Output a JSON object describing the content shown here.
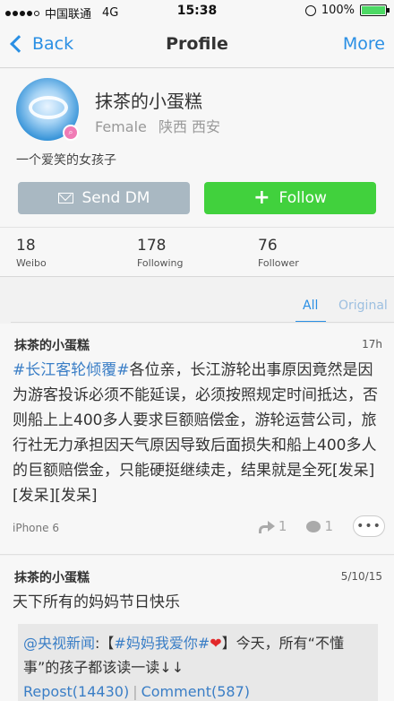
{
  "status_bar": {
    "carrier": "中国联通",
    "network": "4G",
    "time": "15:38",
    "battery": "100%",
    "battery_color": "#4cd964"
  },
  "nav": {
    "back_label": "Back",
    "title": "Profile",
    "more_label": "More",
    "accent_color": "#2a8fe4"
  },
  "profile": {
    "name": "抹茶的小蛋糕",
    "gender": "Female",
    "location": "陕西 西安",
    "bio": "一个爱笑的女孩子",
    "dm_label": "Send DM",
    "follow_label": "Follow",
    "follow_color": "#41d13d"
  },
  "stats": [
    {
      "value": "18",
      "label": "Weibo"
    },
    {
      "value": "178",
      "label": "Following"
    },
    {
      "value": "76",
      "label": "Follower"
    }
  ],
  "tabs": {
    "all": "All",
    "original": "Original"
  },
  "posts": [
    {
      "author": "抹茶的小蛋糕",
      "time": "17h",
      "hashtag": "#长江客轮倾覆#",
      "text": "各位亲，长江游轮出事原因竟然是因为游客投诉必须不能延误，必须按照规定时间抵达，否则船上上400多人要求巨额赔偿金，游轮运营公司，旅行社无力承担因天气原因导致后面损失和船上400多人的巨额赔偿金，只能硬挺继续走，结果就是全死[发呆][发呆][发呆]",
      "source": "iPhone 6",
      "reposts": "1",
      "comments": "1",
      "more": "•••"
    },
    {
      "author": "抹茶的小蛋糕",
      "time": "5/10/15",
      "text": "天下所有的妈妈节日快乐",
      "repost": {
        "source_user": "@央视新闻",
        "colon": ":",
        "bracket_open": "【",
        "hashtag": "#妈妈我爱你#",
        "heart": "❤",
        "bracket_close": "】",
        "text": "今天，所有“不懂事”的孩子都该读一读↓↓",
        "repost_count": "Repost(14430)",
        "separator": "|",
        "comment_count": "Comment(587)"
      }
    }
  ]
}
